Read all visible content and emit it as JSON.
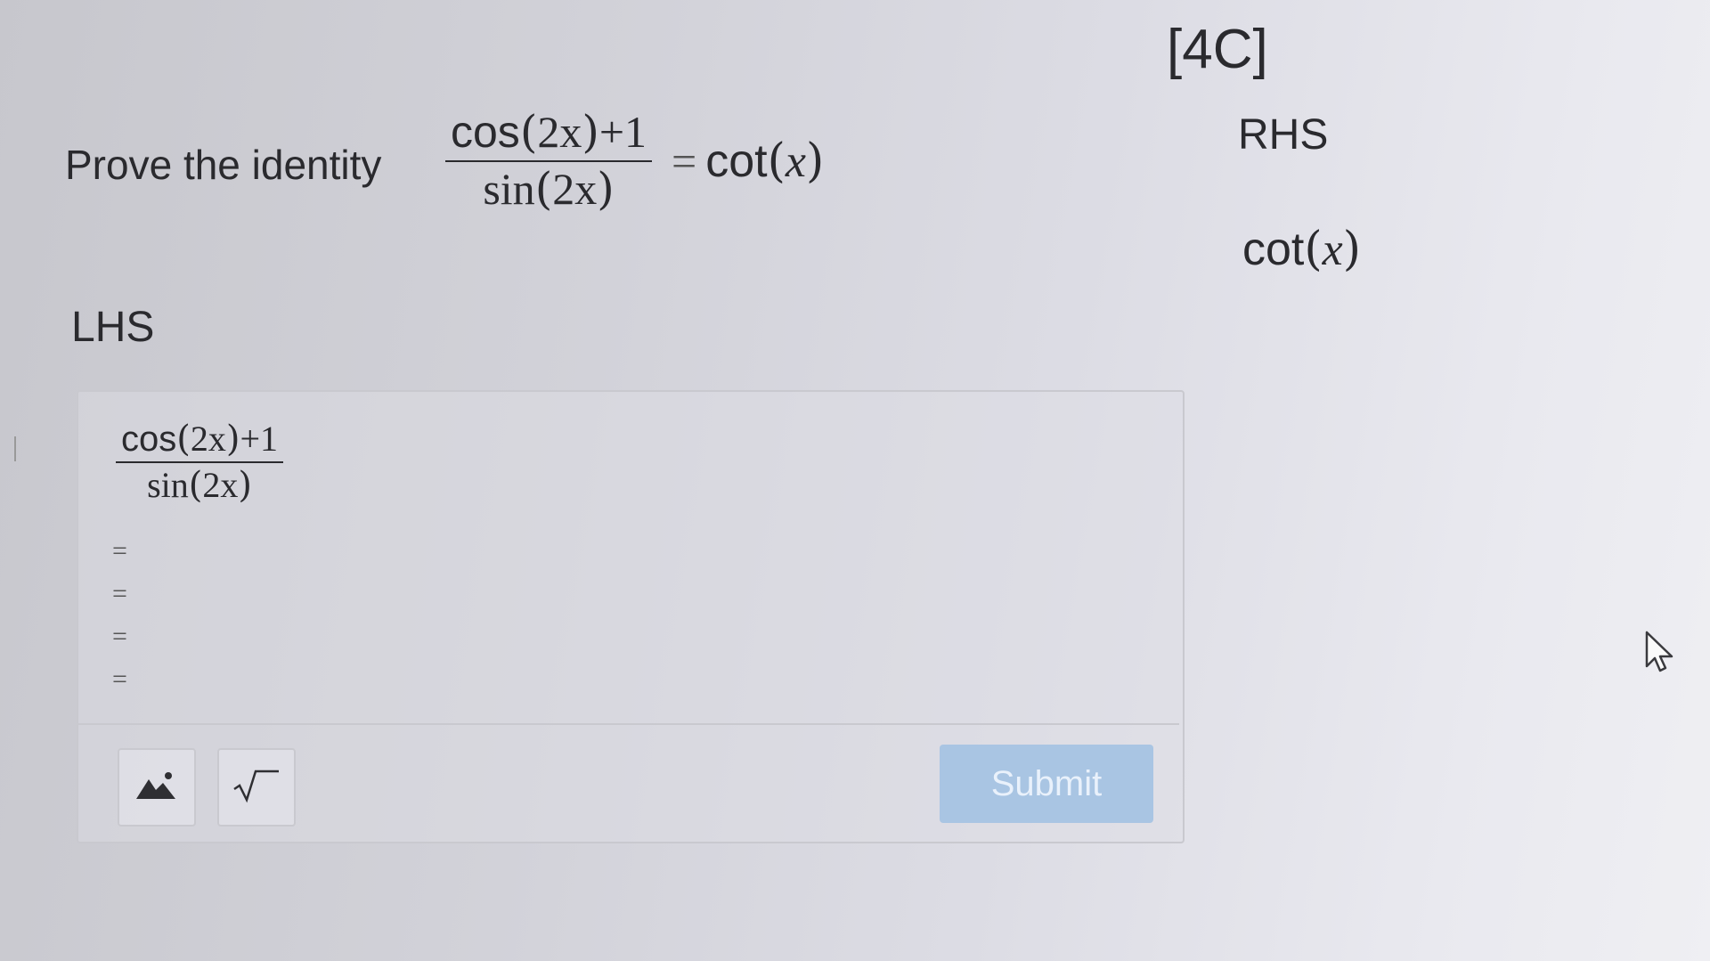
{
  "header": {
    "section_tag": "[4C]"
  },
  "question": {
    "prompt": "Prove the identity",
    "lhs_numerator_fn": "cos",
    "lhs_numerator_arg": "2x",
    "lhs_numerator_tail": "+1",
    "lhs_denominator_fn": "sin",
    "lhs_denominator_arg": "2x",
    "equals": "=",
    "rhs_fn": "cot",
    "rhs_arg": "x"
  },
  "rhs": {
    "label": "RHS",
    "expr_fn": "cot",
    "expr_arg": "x"
  },
  "lhs": {
    "label": "LHS",
    "numerator_fn": "cos",
    "numerator_arg": "2x",
    "numerator_tail": "+1",
    "denominator_fn": "sin",
    "denominator_arg": "2x",
    "steps": [
      "=",
      "=",
      "=",
      "="
    ]
  },
  "toolbar": {
    "image_icon": "image-icon",
    "sqrt_icon": "sqrt-icon",
    "submit_label": "Submit",
    "submit_color": "#a9c5e3"
  },
  "cursor": {
    "icon": "mouse-pointer-icon"
  }
}
